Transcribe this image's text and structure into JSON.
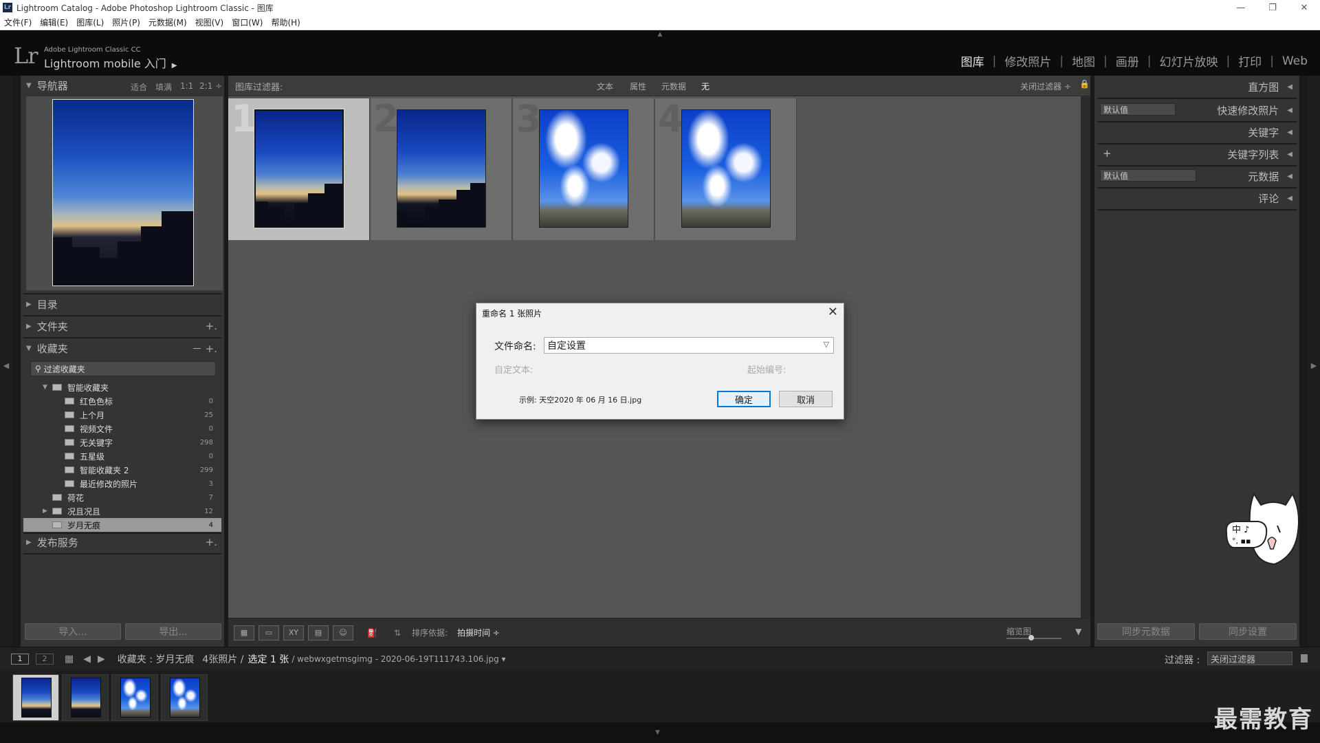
{
  "window": {
    "title": "Lightroom Catalog - Adobe Photoshop Lightroom Classic - 图库",
    "app_icon": "Lr",
    "controls": [
      "—",
      "❐",
      "✕"
    ]
  },
  "menu": [
    "文件(F)",
    "编辑(E)",
    "图库(L)",
    "照片(P)",
    "元数据(M)",
    "视图(V)",
    "窗口(W)",
    "帮助(H)"
  ],
  "identity": {
    "logo": "Lr",
    "product_line": "Adobe Lightroom Classic CC",
    "headline": "Lightroom mobile 入门",
    "headline_arrow": "▶"
  },
  "modules": [
    "图库",
    "修改照片",
    "地图",
    "画册",
    "幻灯片放映",
    "打印",
    "Web"
  ],
  "modules_active_index": 0,
  "left": {
    "navigator": {
      "title": "导航器",
      "zoom": [
        "适合",
        "填满",
        "1:1",
        "2:1 ÷"
      ]
    },
    "catalog": {
      "title": "目录"
    },
    "folders": {
      "title": "文件夹",
      "action": "+."
    },
    "collections": {
      "title": "收藏夹",
      "actions": "－ +.",
      "filter_placeholder": "过滤收藏夹",
      "rows": [
        {
          "label": "智能收藏夹",
          "count": ""
        },
        {
          "label": "红色色标",
          "count": "0"
        },
        {
          "label": "上个月",
          "count": "25"
        },
        {
          "label": "视频文件",
          "count": "0"
        },
        {
          "label": "无关键字",
          "count": "298"
        },
        {
          "label": "五星级",
          "count": "0"
        },
        {
          "label": "智能收藏夹 2",
          "count": "299"
        },
        {
          "label": "最近修改的照片",
          "count": "3"
        },
        {
          "label": "荷花",
          "count": "7"
        },
        {
          "label": "况且况且",
          "count": "12"
        },
        {
          "label": "岁月无痕",
          "count": "4"
        }
      ],
      "selected_index": 10
    },
    "publish": {
      "title": "发布服务",
      "action": "+."
    },
    "import_label": "导入...",
    "export_label": "导出..."
  },
  "filter_bar": {
    "title": "图库过滤器:",
    "options": [
      "文本",
      "属性",
      "元数据",
      "无"
    ],
    "active_option": "无",
    "preset": "关闭过滤器 ÷"
  },
  "grid": {
    "cells": [
      {
        "num": "1",
        "sky": "dusk",
        "selected": true
      },
      {
        "num": "2",
        "sky": "dusk",
        "selected": false
      },
      {
        "num": "3",
        "sky": "blue",
        "selected": false
      },
      {
        "num": "4",
        "sky": "blue",
        "selected": false
      }
    ]
  },
  "toolbar": {
    "sort_label": "排序依据:",
    "sort_value": "拍摄时间 ÷",
    "thumb_label": "缩览图"
  },
  "right": {
    "panels": [
      "直方图",
      "快速修改照片",
      "关键字",
      "关键字列表",
      "元数据",
      "评论"
    ],
    "quick_develop_preset": "默认值",
    "metadata_preset": "默认值",
    "keyword_add": "+",
    "sync_metadata": "同步元数据",
    "sync_settings": "同步设置"
  },
  "filmstrip": {
    "page1": "1",
    "page2": "2",
    "source_prefix": "收藏夹 : 岁月无痕",
    "count_text": "4张照片 /",
    "selected_text": "选定 1 张",
    "filename": "/ webwxgetmsgimg - 2020-06-19T111743.106.jpg ▾",
    "filter_label": "过滤器 :",
    "filter_value": "关闭过滤器"
  },
  "dialog": {
    "title": "重命名 1 张照片",
    "filename_label": "文件命名:",
    "filename_value": "自定设置",
    "custom_text_label": "自定文本:",
    "start_num_label": "起始编号:",
    "example": "示例: 天空2020 年 06 月 16 日.jpg",
    "ok": "确定",
    "cancel": "取消"
  },
  "mascot_text": "中 ♪\n°, 🐾",
  "watermark": "最需教育"
}
